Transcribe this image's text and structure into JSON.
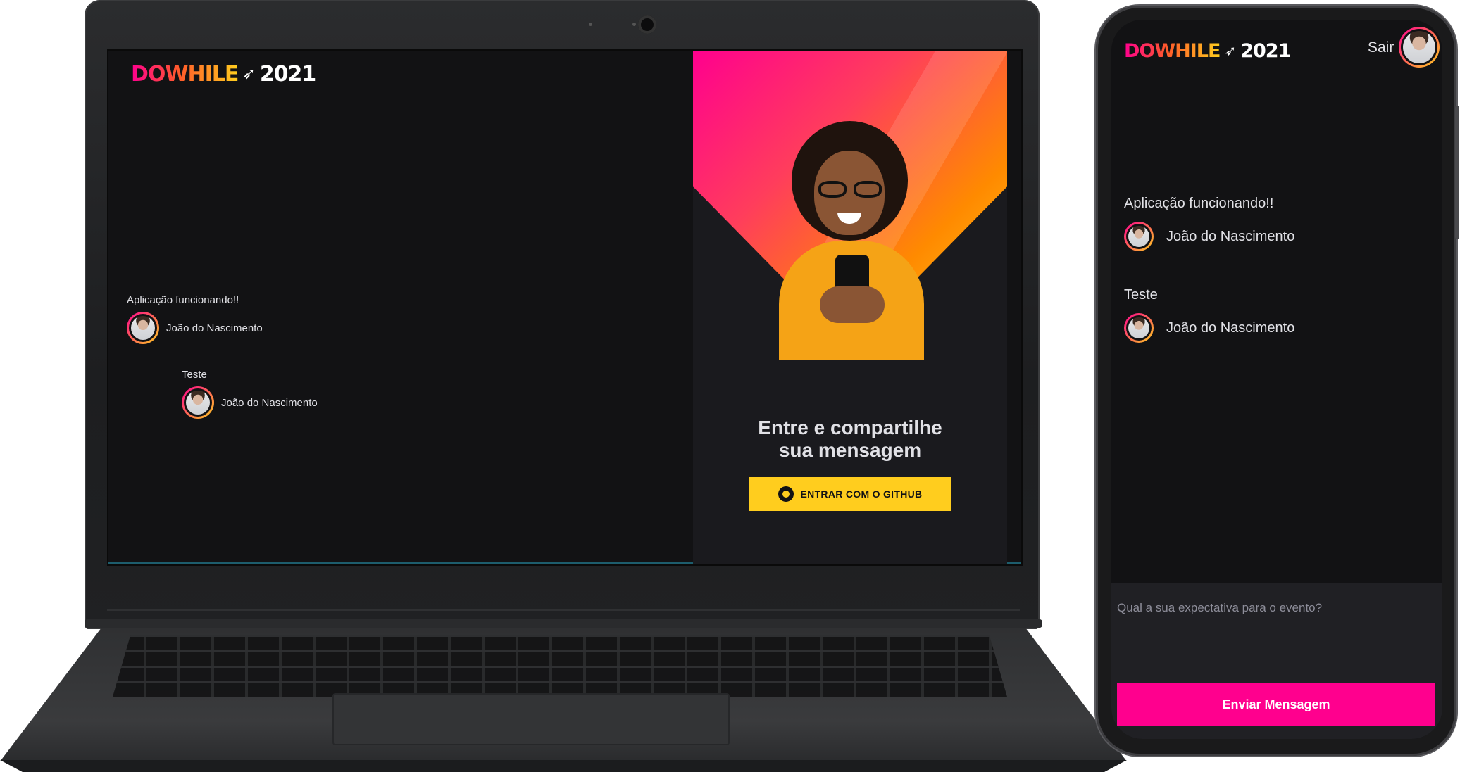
{
  "brand": {
    "logo_word": "DOWHILE",
    "logo_year": "2021",
    "accent_pink": "#ff008e",
    "accent_yellow": "#ffcd1e",
    "background": "#121214"
  },
  "laptop": {
    "messages": [
      {
        "text": "Aplicação funcionando!!",
        "author": "João do Nascimento"
      },
      {
        "text": "Teste",
        "author": "João do Nascimento"
      }
    ],
    "login": {
      "title_line1": "Entre e compartilhe",
      "title_line2": "sua mensagem",
      "github_button": "ENTRAR COM O GITHUB",
      "github_icon": "github-icon"
    }
  },
  "phone": {
    "header": {
      "sign_out": "Sair"
    },
    "messages": [
      {
        "text": "Aplicação funcionando!!",
        "author": "João do Nascimento"
      },
      {
        "text": "Teste",
        "author": "João do Nascimento"
      }
    ],
    "form": {
      "placeholder": "Qual a sua expectativa para o evento?",
      "submit": "Enviar Mensagem"
    }
  }
}
